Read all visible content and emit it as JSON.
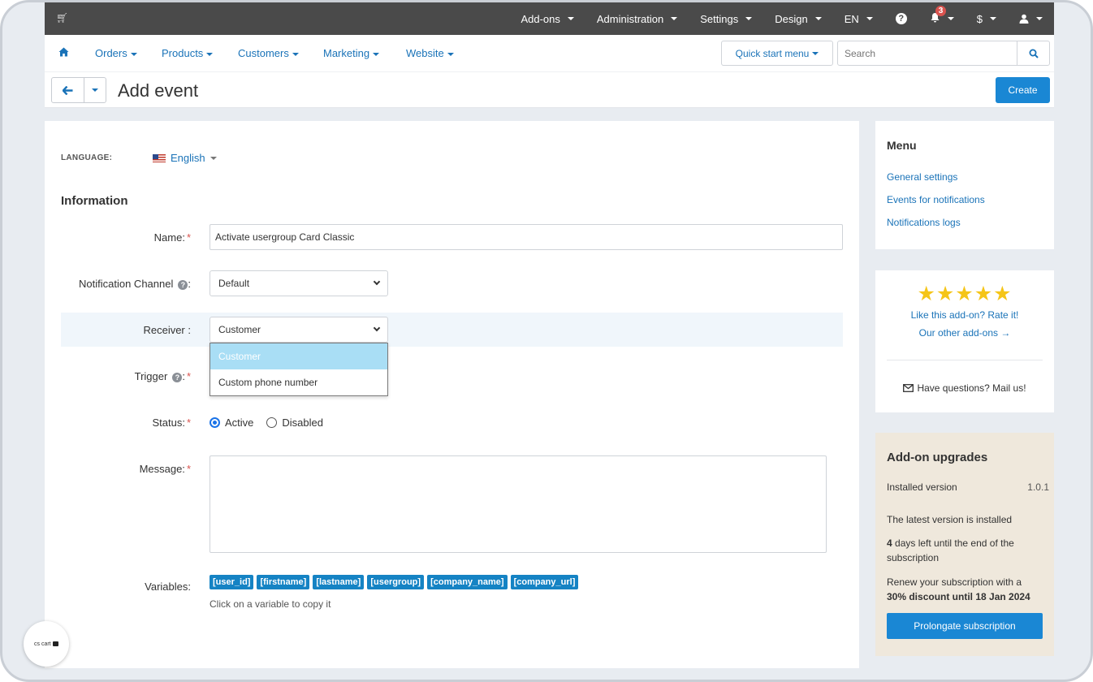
{
  "topbar": {
    "cart_icon": "shopping-cart-icon",
    "items": [
      {
        "label": "Add-ons"
      },
      {
        "label": "Administration"
      },
      {
        "label": "Settings"
      },
      {
        "label": "Design"
      },
      {
        "label": "EN"
      }
    ],
    "help_icon": "question-circle-icon",
    "notifications_count": "3",
    "currency": "$",
    "user_icon": "user-icon"
  },
  "subnav": {
    "home_icon": "home-icon",
    "items": [
      "Orders",
      "Products",
      "Customers",
      "Marketing",
      "Website"
    ],
    "quick_start": "Quick start menu",
    "search_placeholder": "Search",
    "search_icon": "search-icon"
  },
  "titlebar": {
    "title": "Add event",
    "create_label": "Create"
  },
  "form": {
    "language_label": "LANGUAGE:",
    "language_value": "English",
    "section_title": "Information",
    "name_label": "Name:",
    "name_value": "Activate usergroup Card Classic",
    "channel_label": "Notification Channel",
    "channel_value": "Default",
    "receiver_label": "Receiver :",
    "receiver_value": "Customer",
    "receiver_options": [
      "Customer",
      "Custom phone number"
    ],
    "trigger_label": "Trigger",
    "status_label": "Status:",
    "status_options": [
      "Active",
      "Disabled"
    ],
    "status_selected": "Active",
    "message_label": "Message:",
    "message_value": "",
    "variables_label": "Variables:",
    "variables": [
      "[user_id]",
      "[firstname]",
      "[lastname]",
      "[usergroup]",
      "[company_name]",
      "[company_url]"
    ],
    "variables_hint": "Click on a variable to copy it"
  },
  "sidebar_menu": {
    "title": "Menu",
    "links": [
      "General settings",
      "Events for notifications",
      "Notifications logs"
    ]
  },
  "rating": {
    "stars": 5,
    "rate_text": "Like this add-on? Rate it!",
    "other_text": "Our other add-ons →",
    "mail_text": "Have questions? Mail us!"
  },
  "upgrades": {
    "title": "Add-on upgrades",
    "installed_label": "Installed version",
    "installed_version": "1.0.1",
    "latest_text": "The latest version is installed",
    "days_count": "4",
    "days_text": " days left until the end of the subscription",
    "renew_text": "Renew your subscription with a",
    "discount_text": "30% discount until 18 Jan 2024",
    "prolong_label": "Prolongate subscription"
  },
  "logo": {
    "text": "cs cart"
  },
  "colors": {
    "topbar_bg": "#4a4a4a",
    "link": "#1a73b8",
    "primary_button": "#1a87d4",
    "variable_badge": "#1583c4",
    "upgrade_panel": "#efe8dc",
    "star": "#f5c518"
  }
}
